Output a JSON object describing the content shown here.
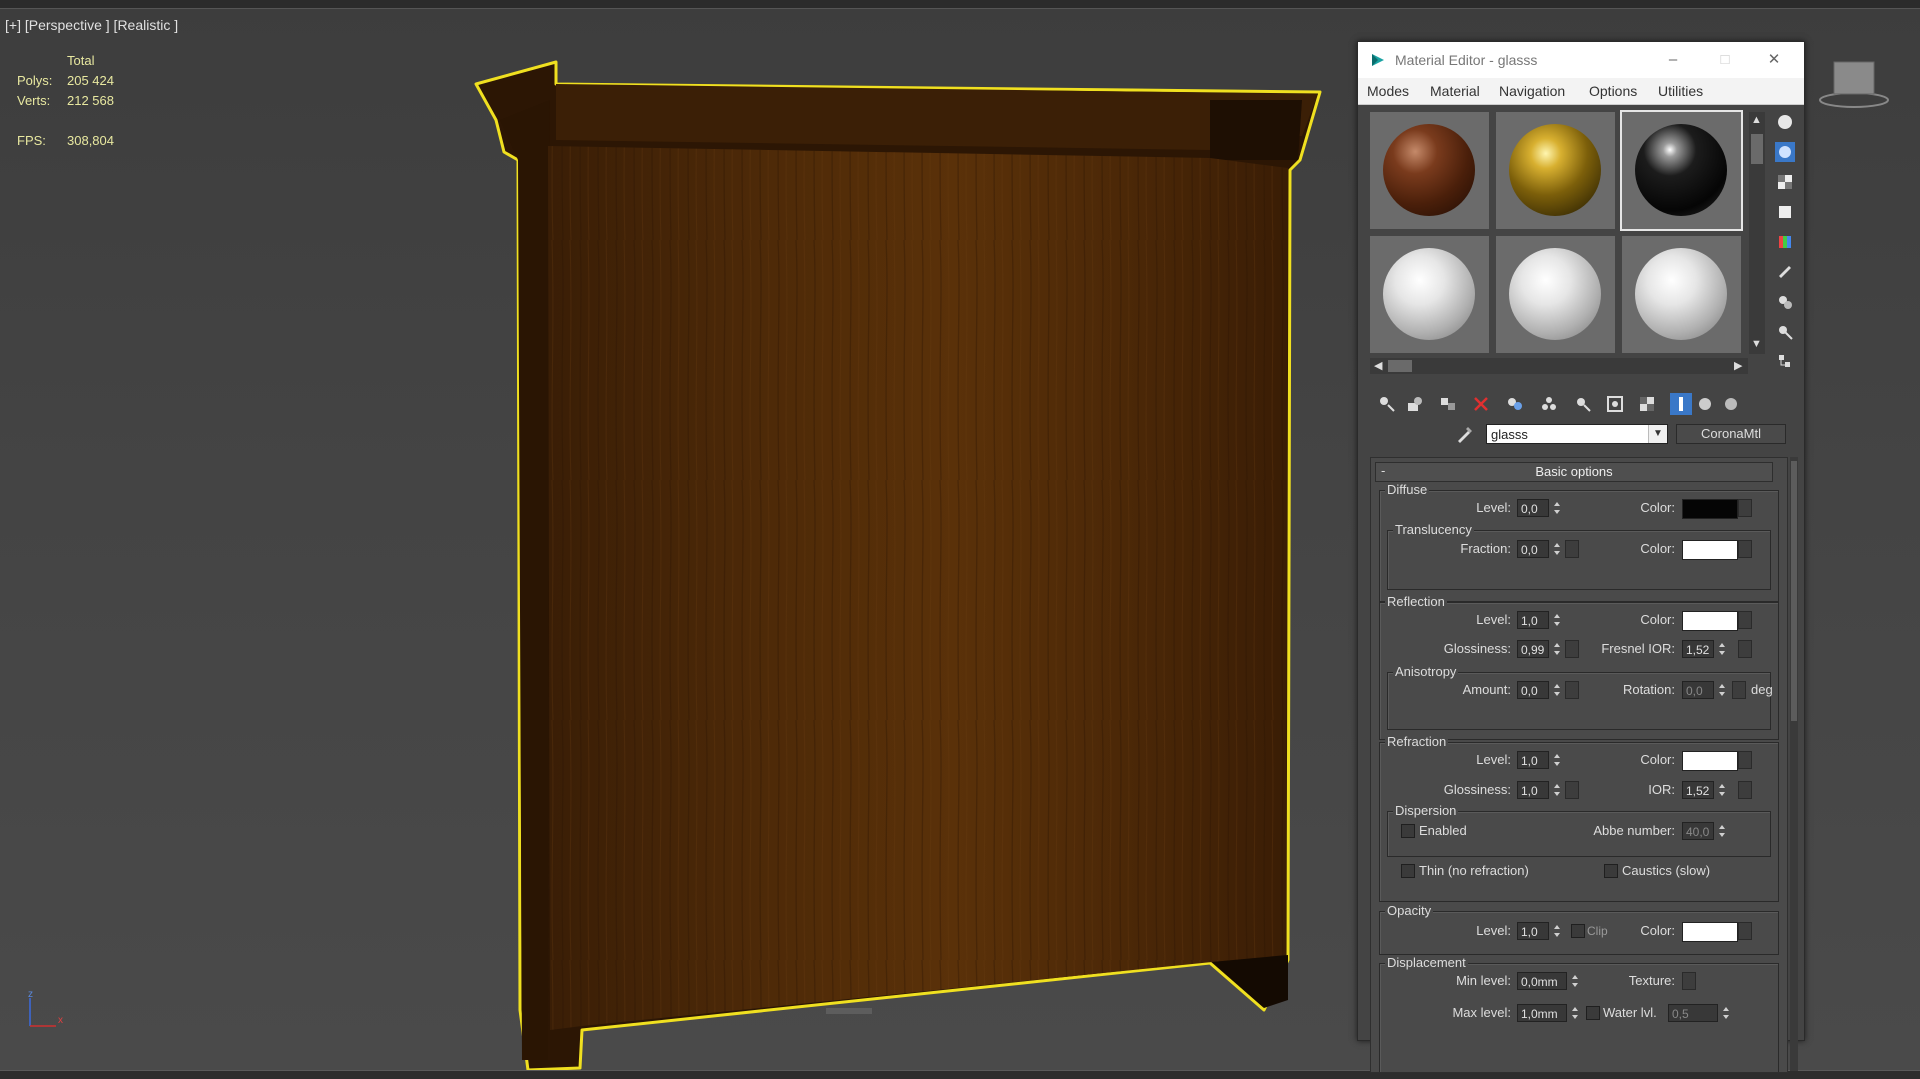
{
  "viewport": {
    "label": "[+] [Perspective ] [Realistic ]",
    "stats": {
      "total_header": "Total",
      "polys_label": "Polys:",
      "polys_value": "205 424",
      "verts_label": "Verts:",
      "verts_value": "212 568",
      "fps_label": "FPS:",
      "fps_value": "308,804"
    },
    "axis": {
      "z": "z",
      "x": "x"
    }
  },
  "material_editor": {
    "title": "Material Editor - glasss",
    "menu": [
      "Modes",
      "Material",
      "Navigation",
      "Options",
      "Utilities"
    ],
    "material_name": "glasss",
    "material_type": "CoronaMtl",
    "rollout_title": "Basic options",
    "diffuse": {
      "group": "Diffuse",
      "level_label": "Level:",
      "level": "0,0",
      "color_label": "Color:",
      "color": "#050505",
      "translucency_group": "Translucency",
      "fraction_label": "Fraction:",
      "fraction": "0,0",
      "trans_color_label": "Color:",
      "trans_color": "#ffffff"
    },
    "reflection": {
      "group": "Reflection",
      "level_label": "Level:",
      "level": "1,0",
      "color_label": "Color:",
      "color": "#ffffff",
      "glossiness_label": "Glossiness:",
      "glossiness": "0,99",
      "fresnel_label": "Fresnel IOR:",
      "fresnel": "1,52",
      "anisotropy_group": "Anisotropy",
      "amount_label": "Amount:",
      "amount": "0,0",
      "rotation_label": "Rotation:",
      "rotation": "0,0",
      "rotation_unit": "deg"
    },
    "refraction": {
      "group": "Refraction",
      "level_label": "Level:",
      "level": "1,0",
      "color_label": "Color:",
      "color": "#ffffff",
      "glossiness_label": "Glossiness:",
      "glossiness": "1,0",
      "ior_label": "IOR:",
      "ior": "1,52",
      "dispersion_group": "Dispersion",
      "enabled_label": "Enabled",
      "abbe_label": "Abbe number:",
      "abbe": "40,0",
      "thin_label": "Thin (no refraction)",
      "caustics_label": "Caustics (slow)"
    },
    "opacity": {
      "group": "Opacity",
      "level_label": "Level:",
      "level": "1,0",
      "clip_label": "Clip",
      "color_label": "Color:",
      "color": "#ffffff"
    },
    "displacement": {
      "group": "Displacement",
      "min_label": "Min level:",
      "min": "0,0mm",
      "texture_label": "Texture:",
      "max_label": "Max level:",
      "max": "1,0mm",
      "water_label": "Water lvl.",
      "water": "0,5"
    }
  }
}
